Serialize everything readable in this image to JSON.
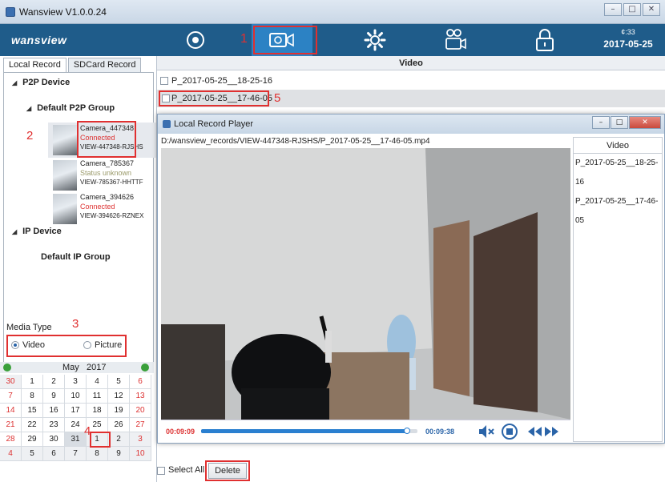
{
  "window": {
    "title": "Wansview  V1.0.0.24",
    "min": "–",
    "max": "□",
    "close": "✕"
  },
  "toolbar": {
    "logo": "wansview",
    "buttons": [
      {
        "icon": "eye-icon",
        "active": false
      },
      {
        "icon": "record-video-icon",
        "active": true,
        "tag": "1"
      },
      {
        "icon": "gear-icon",
        "active": false
      },
      {
        "icon": "tape-record-icon",
        "active": false
      },
      {
        "icon": "lock-icon",
        "active": false
      }
    ],
    "time_label": "¢:33",
    "date": "2017-05-25"
  },
  "left": {
    "tabs": [
      "Local Record",
      "SDCard Record"
    ],
    "tree": {
      "p2p_device": "P2P Device",
      "p2p_group": "Default P2P Group",
      "cameras": [
        {
          "name": "Camera_447348",
          "status": "Connected",
          "status_color": "#d33",
          "id": "VIEW-447348-RJSHS",
          "selected": true
        },
        {
          "name": "Camera_785367",
          "status": "Status unknown",
          "status_color": "#9a9a6a",
          "id": "VIEW-785367-HHTTF",
          "selected": false
        },
        {
          "name": "Camera_394626",
          "status": "Connected",
          "status_color": "#d33",
          "id": "VIEW-394626-RZNEX",
          "selected": false
        }
      ],
      "ip_device": "IP Device",
      "ip_group": "Default IP Group"
    },
    "tag_camera": "2",
    "media_type": {
      "label": "Media Type",
      "tag": "3",
      "video": "Video",
      "picture": "Picture",
      "selected": "Video"
    },
    "calendar": {
      "month": "May",
      "year": "2017",
      "tag": "4",
      "days": [
        [
          "30",
          "1",
          "2",
          "3",
          "4",
          "5",
          "6"
        ],
        [
          "7",
          "8",
          "9",
          "10",
          "11",
          "12",
          "13"
        ],
        [
          "14",
          "15",
          "16",
          "17",
          "18",
          "19",
          "20"
        ],
        [
          "21",
          "22",
          "23",
          "24",
          "25",
          "26",
          "27"
        ],
        [
          "28",
          "29",
          "30",
          "31",
          "1",
          "2",
          "3"
        ],
        [
          "4",
          "5",
          "6",
          "7",
          "8",
          "9",
          "10"
        ]
      ],
      "selected_day": "25"
    }
  },
  "main": {
    "header": "Video",
    "files": [
      "P_2017-05-25__18-25-16",
      "P_2017-05-25__17-46-05"
    ],
    "tag_file": "5",
    "select_all": "Select All",
    "delete": "Delete"
  },
  "player": {
    "title": "Local Record Player",
    "path": "D:/wansview_records/VIEW-447348-RJSHS/P_2017-05-25__17-46-05.mp4",
    "current_time": "00:09:09",
    "total_time": "00:09:38",
    "progress": 0.95,
    "list_header": "Video",
    "list": [
      "P_2017-05-25__18-25-16",
      "P_2017-05-25__17-46-05"
    ]
  },
  "colors": {
    "toolbar": "#1f5c8a",
    "active": "#2c82c4",
    "annotation": "#e03030"
  }
}
